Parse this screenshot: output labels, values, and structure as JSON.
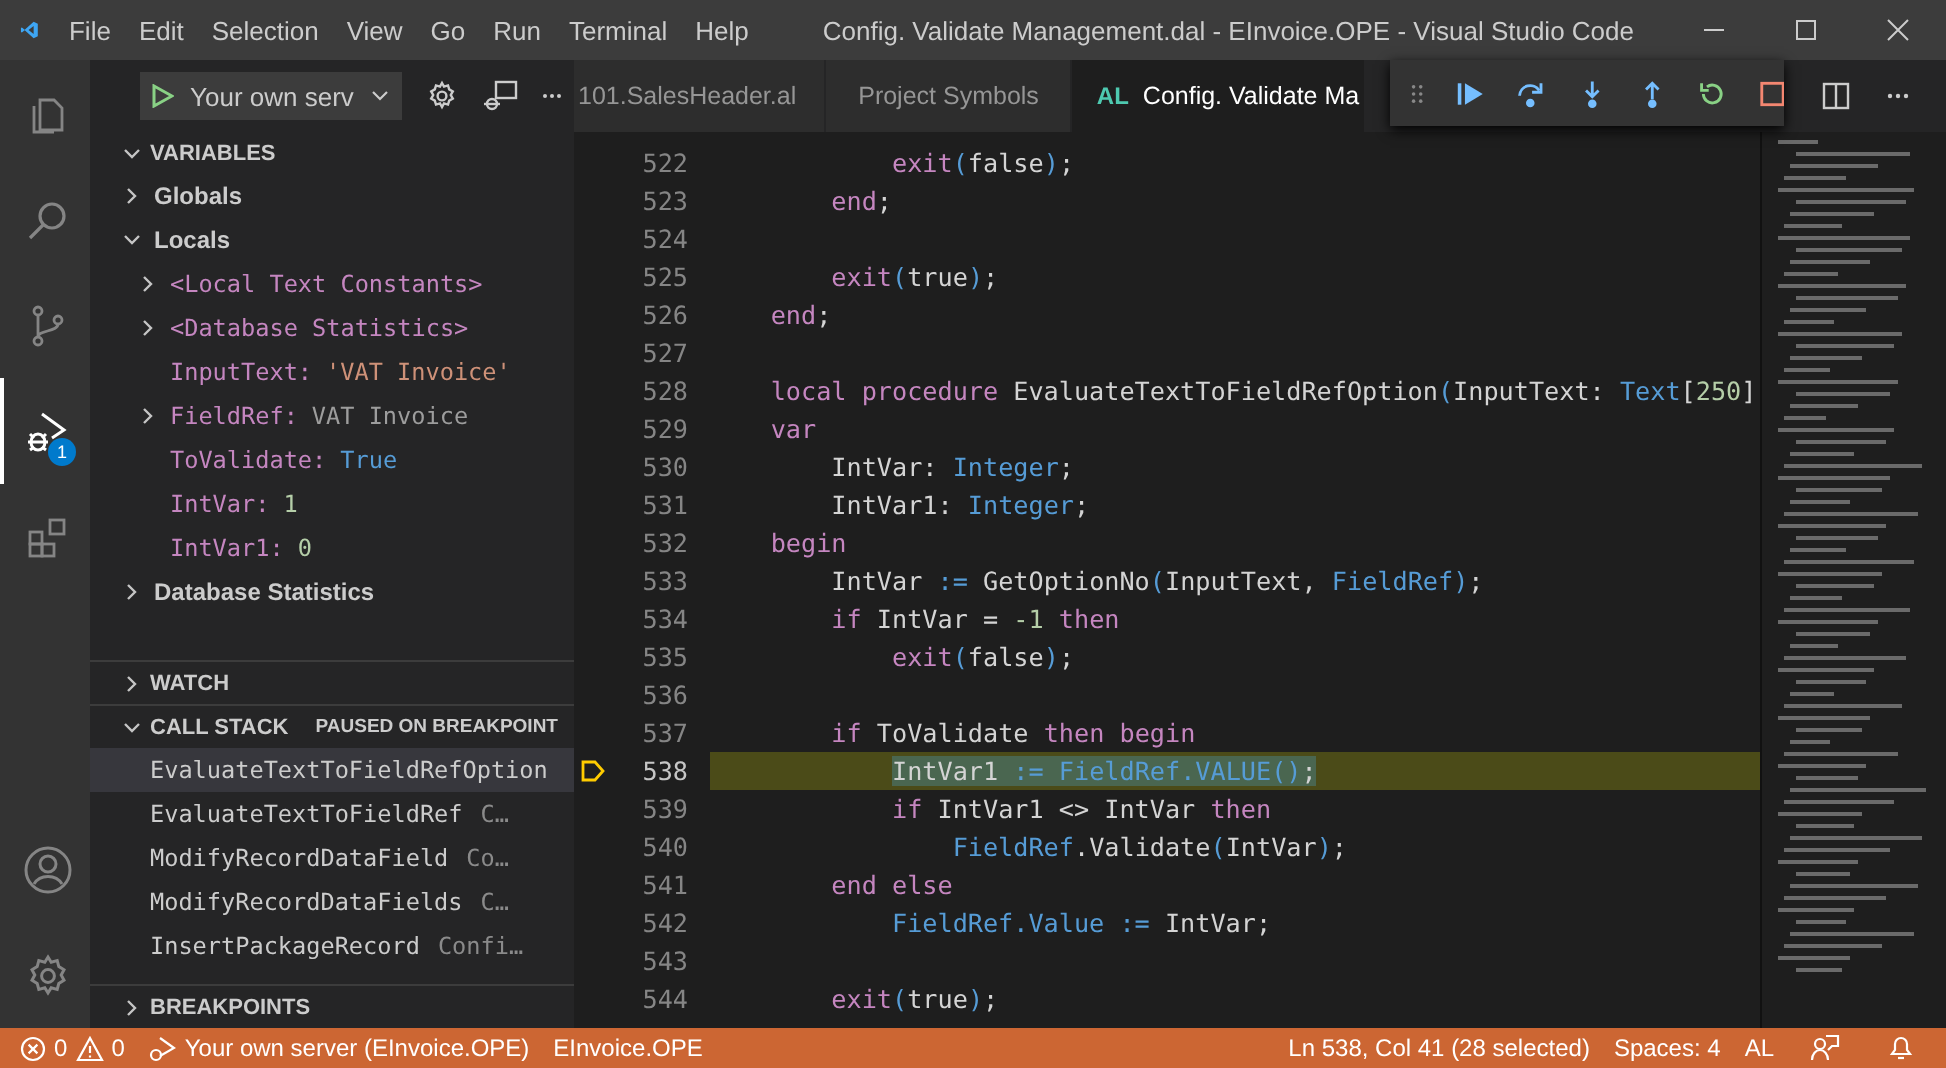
{
  "title_bar": {
    "menu": [
      "File",
      "Edit",
      "Selection",
      "View",
      "Go",
      "Run",
      "Terminal",
      "Help"
    ],
    "title": "Config. Validate Management.dal - EInvoice.OPE - Visual Studio Code"
  },
  "activity_bar": {
    "items": [
      {
        "kind": "files",
        "selected": false
      },
      {
        "kind": "search",
        "selected": false
      },
      {
        "kind": "source-control",
        "selected": false
      },
      {
        "kind": "debug",
        "selected": true,
        "badge": "1"
      },
      {
        "kind": "extensions",
        "selected": false
      }
    ],
    "bottom": [
      {
        "kind": "account",
        "selected": false
      },
      {
        "kind": "settings",
        "selected": false
      }
    ]
  },
  "run_toolbar": {
    "configuration": "Your own serv"
  },
  "variables": {
    "title": "VARIABLES",
    "expanded": true,
    "items": [
      {
        "name": "Globals",
        "kind": "scope",
        "expanded": false
      },
      {
        "name": "Locals",
        "kind": "scope",
        "expanded": true,
        "children": [
          {
            "name": "<Local Text Constants>",
            "kind": "group",
            "expanded": false
          },
          {
            "name": "<Database Statistics>",
            "kind": "group",
            "expanded": false
          },
          {
            "name": "InputText:",
            "value": "'VAT Invoice'",
            "kind": "string"
          },
          {
            "name": "FieldRef:",
            "value": "VAT Invoice",
            "kind": "object",
            "expanded": false
          },
          {
            "name": "ToValidate:",
            "value": "True",
            "kind": "boolean"
          },
          {
            "name": "IntVar:",
            "value": "1",
            "kind": "number"
          },
          {
            "name": "IntVar1:",
            "value": "0",
            "kind": "number"
          }
        ]
      },
      {
        "name": "Database Statistics",
        "kind": "scope",
        "expanded": false
      }
    ]
  },
  "watch": {
    "title": "WATCH",
    "expanded": false
  },
  "call_stack": {
    "title": "CALL STACK",
    "expanded": true,
    "status": "PAUSED ON BREAKPOINT",
    "frames": [
      {
        "name": "EvaluateTextToFieldRefOption",
        "selected": true
      },
      {
        "name": "EvaluateTextToFieldRef",
        "source": "C…",
        "selected": false
      },
      {
        "name": "ModifyRecordDataField",
        "source": "Co…",
        "selected": false
      },
      {
        "name": "ModifyRecordDataFields",
        "source": "C…",
        "selected": false
      },
      {
        "name": "InsertPackageRecord",
        "source": "Confi…",
        "selected": false
      }
    ]
  },
  "breakpoints": {
    "title": "BREAKPOINTS",
    "expanded": false
  },
  "tabs": [
    {
      "label": "101.SalesHeader.al",
      "selected": false
    },
    {
      "label": "Project Symbols",
      "selected": false
    },
    {
      "label": "Config. Validate Ma",
      "icon_text": "AL",
      "selected": true
    }
  ],
  "editor": {
    "lines": [
      {
        "number": "522",
        "tokens": [
          {
            "kind": "keyword",
            "s": "            exit"
          },
          {
            "kind": "punctuation",
            "s": "("
          },
          {
            "kind": "plain",
            "s": "false"
          },
          {
            "kind": "punctuation",
            "s": ")"
          },
          {
            "kind": "plain",
            "s": ";"
          }
        ]
      },
      {
        "number": "523",
        "tokens": [
          {
            "kind": "keyword",
            "s": "        end"
          },
          {
            "kind": "plain",
            "s": ";"
          }
        ]
      },
      {
        "number": "524"
      },
      {
        "number": "525",
        "tokens": [
          {
            "kind": "keyword",
            "s": "        exit"
          },
          {
            "kind": "punctuation",
            "s": "("
          },
          {
            "kind": "plain",
            "s": "true"
          },
          {
            "kind": "punctuation",
            "s": ")"
          },
          {
            "kind": "plain",
            "s": ";"
          }
        ]
      },
      {
        "number": "526",
        "tokens": [
          {
            "kind": "keyword",
            "s": "    end"
          },
          {
            "kind": "plain",
            "s": ";"
          }
        ]
      },
      {
        "number": "527"
      },
      {
        "number": "528",
        "tokens": [
          {
            "kind": "keyword",
            "s": "    local procedure"
          },
          {
            "kind": "plain",
            "s": " EvaluateTextToFieldRefOption"
          },
          {
            "kind": "punctuation",
            "s": "("
          },
          {
            "kind": "plain",
            "s": "InputText: "
          },
          {
            "kind": "type",
            "s": "Text"
          },
          {
            "kind": "plain",
            "s": "["
          },
          {
            "kind": "number",
            "s": "250"
          },
          {
            "kind": "plain",
            "s": "]"
          }
        ]
      },
      {
        "number": "529",
        "tokens": [
          {
            "kind": "keyword",
            "s": "    var"
          }
        ]
      },
      {
        "number": "530",
        "tokens": [
          {
            "kind": "plain",
            "s": "        IntVar: "
          },
          {
            "kind": "type",
            "s": "Integer"
          },
          {
            "kind": "plain",
            "s": ";"
          }
        ]
      },
      {
        "number": "531",
        "tokens": [
          {
            "kind": "plain",
            "s": "        IntVar1: "
          },
          {
            "kind": "type",
            "s": "Integer"
          },
          {
            "kind": "plain",
            "s": ";"
          }
        ]
      },
      {
        "number": "532",
        "tokens": [
          {
            "kind": "keyword",
            "s": "    begin"
          }
        ]
      },
      {
        "number": "533",
        "tokens": [
          {
            "kind": "plain",
            "s": "        IntVar "
          },
          {
            "kind": "type",
            "s": ":="
          },
          {
            "kind": "plain",
            "s": " GetOptionNo"
          },
          {
            "kind": "punctuation",
            "s": "("
          },
          {
            "kind": "plain",
            "s": "InputText, "
          },
          {
            "kind": "type",
            "s": "FieldRef"
          },
          {
            "kind": "punctuation",
            "s": ")"
          },
          {
            "kind": "plain",
            "s": ";"
          }
        ]
      },
      {
        "number": "534",
        "tokens": [
          {
            "kind": "keyword",
            "s": "        if"
          },
          {
            "kind": "plain",
            "s": " IntVar = "
          },
          {
            "kind": "number",
            "s": "-1"
          },
          {
            "kind": "keyword",
            "s": " then"
          }
        ]
      },
      {
        "number": "535",
        "tokens": [
          {
            "kind": "keyword",
            "s": "            exit"
          },
          {
            "kind": "punctuation",
            "s": "("
          },
          {
            "kind": "plain",
            "s": "false"
          },
          {
            "kind": "punctuation",
            "s": ")"
          },
          {
            "kind": "plain",
            "s": ";"
          }
        ]
      },
      {
        "number": "536"
      },
      {
        "number": "537",
        "tokens": [
          {
            "kind": "keyword",
            "s": "        if"
          },
          {
            "kind": "plain",
            "s": " ToValidate "
          },
          {
            "kind": "keyword",
            "s": "then begin"
          }
        ]
      },
      {
        "number": "538",
        "current": true,
        "tokens": [
          {
            "kind": "plain",
            "s": "            IntVar1 ",
            "selected": true
          },
          {
            "kind": "type",
            "s": ":= ",
            "selected": true
          },
          {
            "kind": "type",
            "s": "FieldRef.VALUE",
            "selected": true
          },
          {
            "kind": "punctuation",
            "s": "()",
            "selected": true
          },
          {
            "kind": "plain",
            "s": ";",
            "selected": true
          }
        ]
      },
      {
        "number": "539",
        "tokens": [
          {
            "kind": "keyword",
            "s": "            if"
          },
          {
            "kind": "plain",
            "s": " IntVar1 <> IntVar "
          },
          {
            "kind": "keyword",
            "s": "then"
          }
        ]
      },
      {
        "number": "540",
        "tokens": [
          {
            "kind": "type",
            "s": "                FieldRef"
          },
          {
            "kind": "plain",
            "s": ".Validate"
          },
          {
            "kind": "punctuation",
            "s": "("
          },
          {
            "kind": "plain",
            "s": "IntVar"
          },
          {
            "kind": "punctuation",
            "s": ")"
          },
          {
            "kind": "plain",
            "s": ";"
          }
        ]
      },
      {
        "number": "541",
        "tokens": [
          {
            "kind": "keyword",
            "s": "        end else"
          }
        ]
      },
      {
        "number": "542",
        "tokens": [
          {
            "kind": "type",
            "s": "            FieldRef.Value :="
          },
          {
            "kind": "plain",
            "s": " IntVar;"
          }
        ]
      },
      {
        "number": "543"
      },
      {
        "number": "544",
        "tokens": [
          {
            "kind": "keyword",
            "s": "        exit"
          },
          {
            "kind": "punctuation",
            "s": "("
          },
          {
            "kind": "plain",
            "s": "true"
          },
          {
            "kind": "punctuation",
            "s": ")"
          },
          {
            "kind": "plain",
            "s": ";"
          }
        ]
      }
    ]
  },
  "status_bar": {
    "errors": "0",
    "warnings": "0",
    "server": "Your own server (EInvoice.OPE)",
    "workspace": "EInvoice.OPE",
    "cursor": "Ln 538, Col 41 (28 selected)",
    "indentation": "Spaces: 4",
    "language": "AL"
  }
}
